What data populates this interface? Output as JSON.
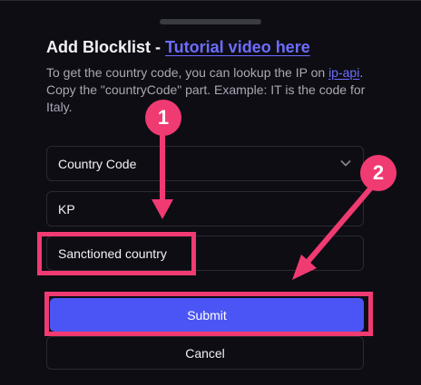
{
  "dialog": {
    "title_prefix": "Add Blocklist - ",
    "title_link": "Tutorial video here",
    "desc_before": "To get the country code, you can lookup the IP on ",
    "desc_link": "ip-api",
    "desc_after": ". Copy the \"countryCode\" part. Example: IT is the code for Italy."
  },
  "form": {
    "type_select_value": "Country Code",
    "code_value": "KP",
    "name_value": "Sanctioned country",
    "submit_label": "Submit",
    "cancel_label": "Cancel"
  },
  "annotations": {
    "step1": "1",
    "step2": "2",
    "highlight_color": "#f03a72"
  },
  "colors": {
    "background": "#0e0d14",
    "accent": "#4b55f5",
    "link": "#6d6dff"
  }
}
